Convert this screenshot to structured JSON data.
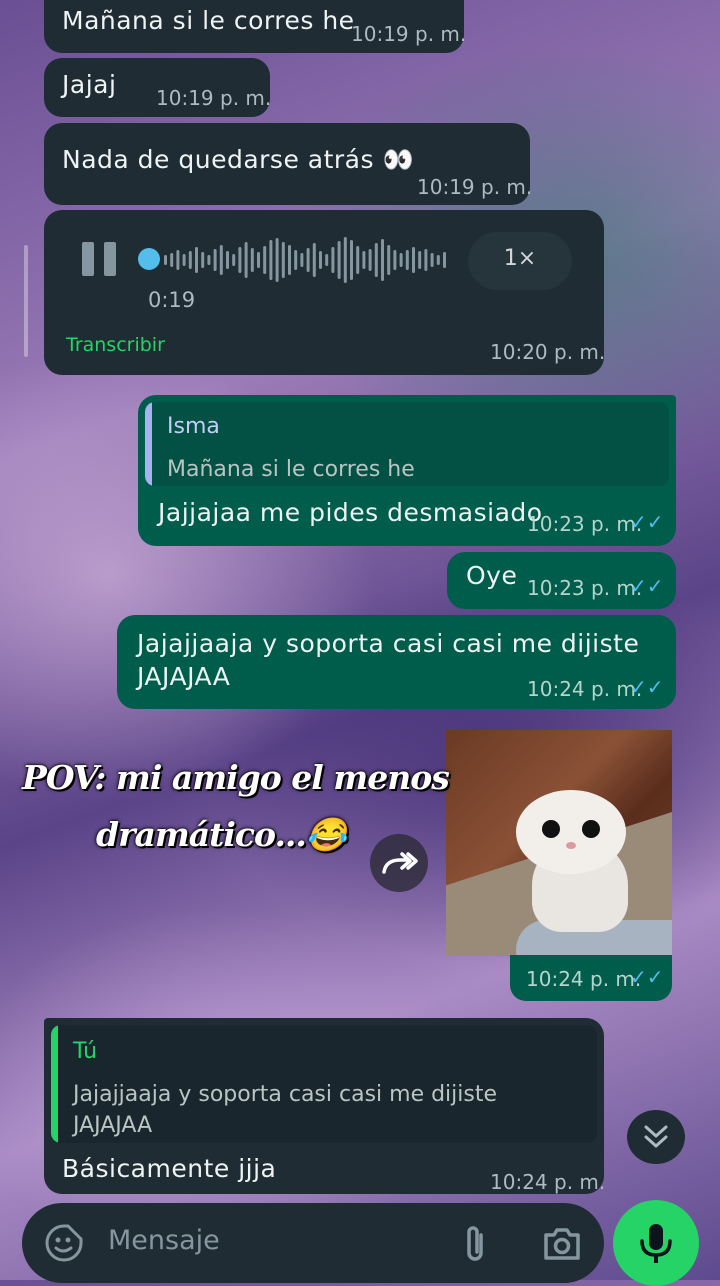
{
  "messages": {
    "m1": {
      "text": "Mañana si le corres he",
      "time": "10:19 p. m."
    },
    "m2": {
      "text": "Jajaj",
      "time": "10:19 p. m."
    },
    "m3": {
      "text": "Nada de quedarse atrás 👀",
      "time": "10:19 p. m."
    },
    "voice": {
      "duration": "0:19",
      "speed": "1×",
      "transcribe": "Transcribir",
      "time": "10:20 p. m."
    },
    "m5": {
      "reply_name": "Isma",
      "reply_text": "Mañana si le corres he",
      "text": "Jajjajaa me pides desmasiado",
      "time": "10:23 p. m."
    },
    "m6": {
      "text": "Oye",
      "time": "10:23 p. m."
    },
    "m7": {
      "line1": "Jajajjaaja y soporta casi casi me dijiste",
      "line2": "JAJAJAA",
      "time": "10:24 p. m."
    },
    "m8": {
      "time": "10:24 p. m."
    },
    "m9": {
      "reply_name": "Tú",
      "reply_line1": "Jajajjaaja y soporta casi casi me dijiste",
      "reply_line2": "JAJAJAA",
      "text": "Básicamente jjja",
      "time": "10:24 p. m."
    }
  },
  "overlay": {
    "line1": "POV: mi amigo el menos",
    "line2": "dramático...😂"
  },
  "composer": {
    "placeholder": "Mensaje"
  },
  "colors": {
    "incoming": "#1f2c33",
    "outgoing": "#005c4b",
    "accent_green": "#25d366",
    "read_ticks": "#53bdeb"
  },
  "icons": [
    "pause-icon",
    "forward-icon",
    "scroll-down-icon",
    "sticker-icon",
    "attach-icon",
    "camera-icon",
    "mic-icon"
  ]
}
